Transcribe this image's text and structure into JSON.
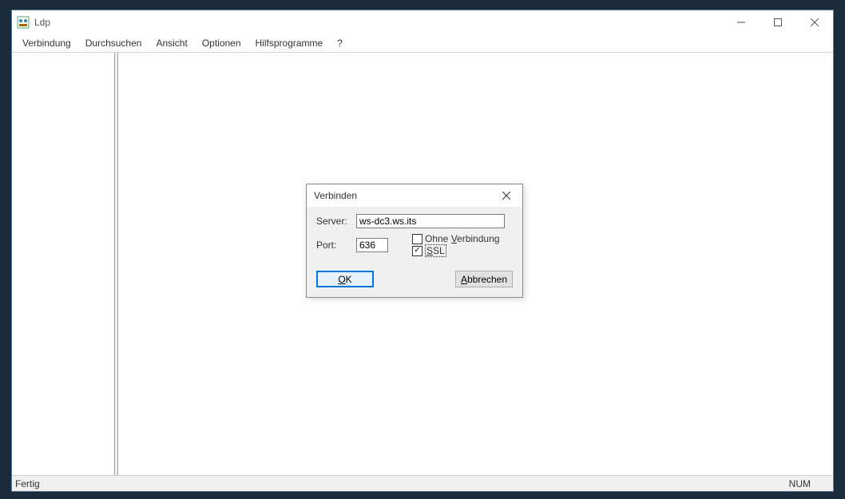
{
  "titlebar": {
    "title": "Ldp"
  },
  "menu": {
    "items": [
      "Verbindung",
      "Durchsuchen",
      "Ansicht",
      "Optionen",
      "Hilfsprogramme",
      "?"
    ]
  },
  "statusbar": {
    "left": "Fertig",
    "num": "NUM"
  },
  "dialog": {
    "title": "Verbinden",
    "server_label": "Server:",
    "server_value": "ws-dc3.ws.its",
    "port_label": "Port:",
    "port_value": "636",
    "no_conn_label_prefix": "Ohne ",
    "no_conn_label_accel": "V",
    "no_conn_label_suffix": "erbindung",
    "no_conn_checked": false,
    "ssl_label_accel": "S",
    "ssl_label_suffix": "SL",
    "ssl_checked": true,
    "ok_accel": "O",
    "ok_suffix": "K",
    "cancel_accel": "A",
    "cancel_suffix": "bbrechen"
  }
}
